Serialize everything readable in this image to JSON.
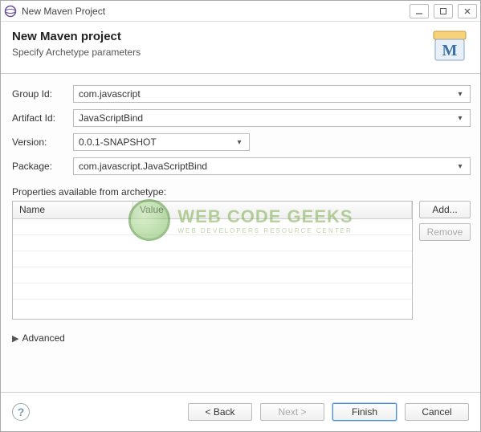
{
  "window": {
    "title": "New Maven Project"
  },
  "header": {
    "title": "New Maven project",
    "subtitle": "Specify Archetype parameters"
  },
  "form": {
    "groupId": {
      "label": "Group Id:",
      "value": "com.javascript"
    },
    "artifactId": {
      "label": "Artifact Id:",
      "value": "JavaScriptBind"
    },
    "version": {
      "label": "Version:",
      "value": "0.0.1-SNAPSHOT"
    },
    "package": {
      "label": "Package:",
      "value": "com.javascript.JavaScriptBind"
    }
  },
  "properties": {
    "label": "Properties available from archetype:",
    "columns": {
      "name": "Name",
      "value": "Value"
    },
    "buttons": {
      "add": "Add...",
      "remove": "Remove"
    }
  },
  "advanced": {
    "label": "Advanced"
  },
  "footer": {
    "back": "< Back",
    "next": "Next >",
    "finish": "Finish",
    "cancel": "Cancel"
  },
  "watermark": {
    "main": "WEB CODE GEEKS",
    "sub": "WEB DEVELOPERS RESOURCE CENTER"
  }
}
